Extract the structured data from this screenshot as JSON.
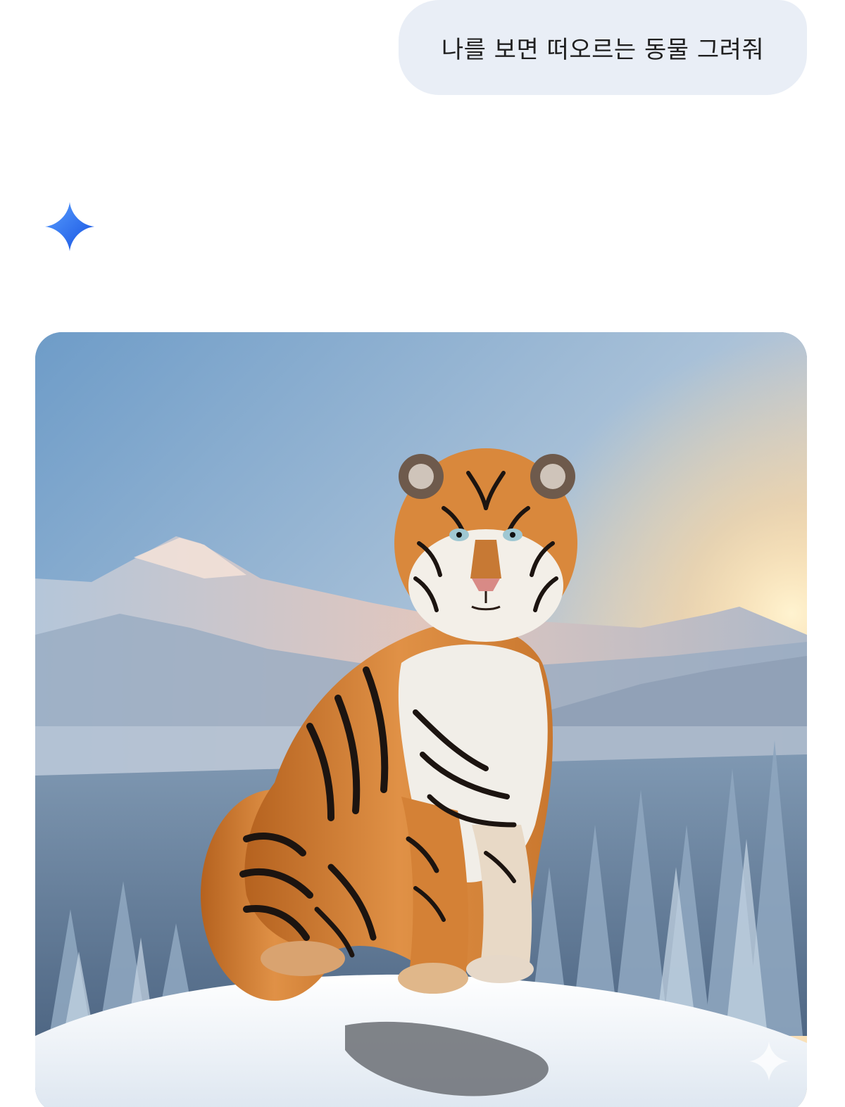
{
  "conversation": {
    "user_message": "나를 보면 떠오르는 동물 그려줘",
    "assistant_icon": "gemini-sparkle-icon",
    "generated_image": {
      "subject": "tiger",
      "watermark_icon": "sparkle-watermark-icon"
    }
  },
  "colors": {
    "bubble_bg": "#e9eef6",
    "sparkle_start": "#4a8cff",
    "sparkle_end": "#1a5ee8",
    "text": "#1f1f1f"
  }
}
